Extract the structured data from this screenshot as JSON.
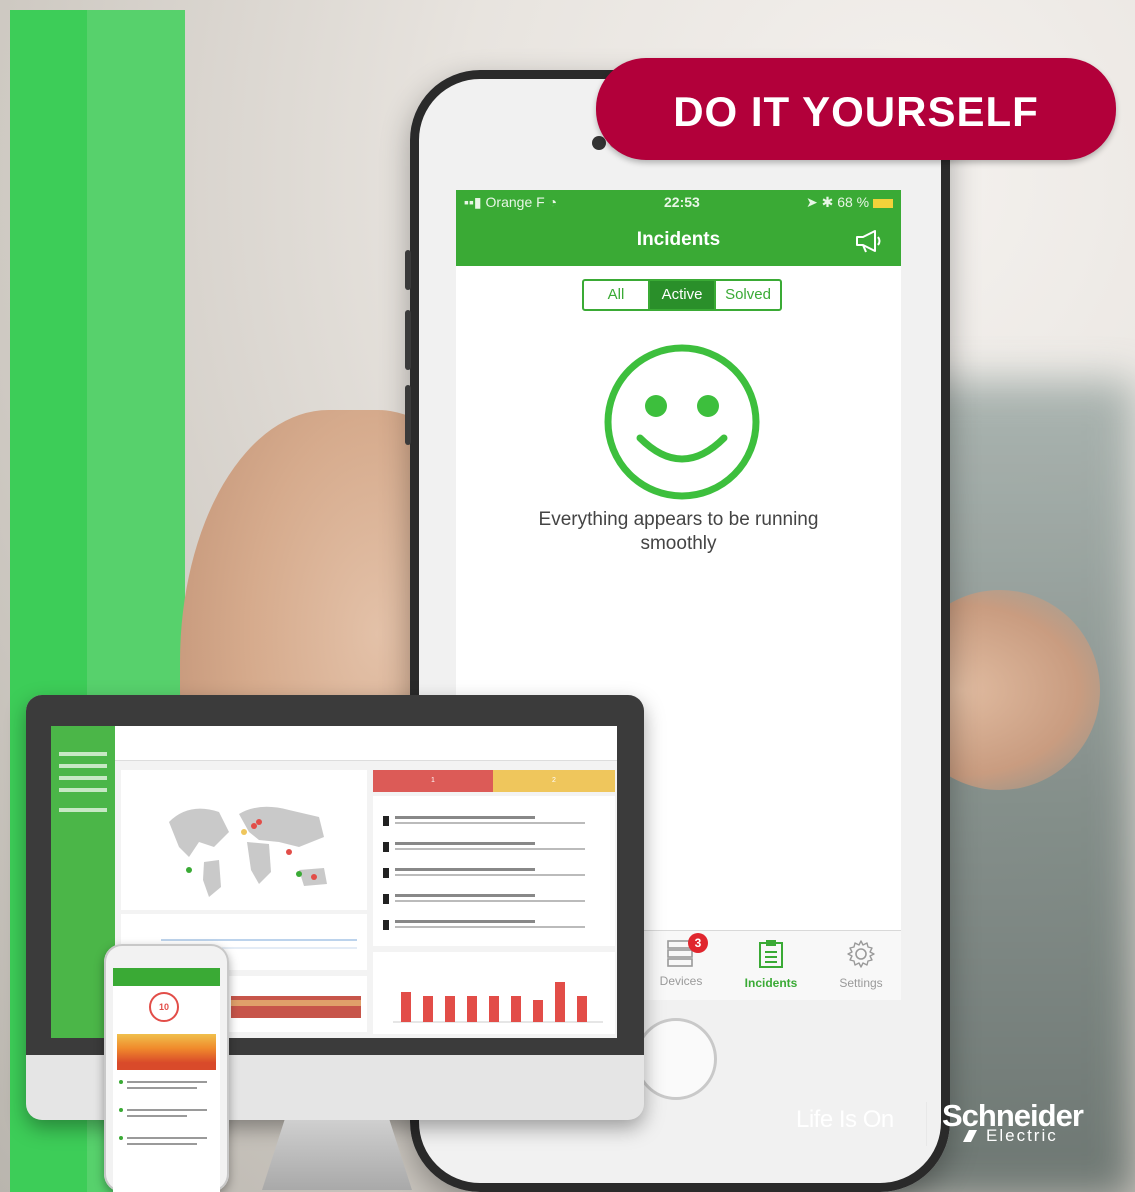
{
  "banner": {
    "label": "DO IT YOURSELF",
    "color": "#b2003a"
  },
  "colors": {
    "brand_green": "#3dcd58",
    "app_green": "#3aaa35",
    "active_segment": "#2a8f2a",
    "alert_red": "#e0262e"
  },
  "phone": {
    "status_bar": {
      "carrier": "Orange F",
      "time": "22:53",
      "battery": "68 %"
    },
    "nav": {
      "title": "Incidents",
      "action_icon": "megaphone-icon"
    },
    "segments": [
      {
        "label": "All",
        "active": false
      },
      {
        "label": "Active",
        "active": true
      },
      {
        "label": "Solved",
        "active": false
      }
    ],
    "empty_state": {
      "icon": "smiley-icon",
      "message": "Everything appears to be running smoothly"
    },
    "tabbar": {
      "devices": {
        "label": "Devices",
        "badge": "3",
        "icon": "devices-icon"
      },
      "incidents": {
        "label": "Incidents",
        "icon": "clipboard-icon"
      },
      "settings": {
        "label": "Settings",
        "icon": "gear-icon"
      }
    }
  },
  "desktop": {
    "stat_red": "1",
    "stat_yellow": "2"
  },
  "mini_phone": {
    "dial_value": "10"
  },
  "brand": {
    "tagline": "Life Is On",
    "company": "Schneider",
    "sub": "Electric"
  }
}
